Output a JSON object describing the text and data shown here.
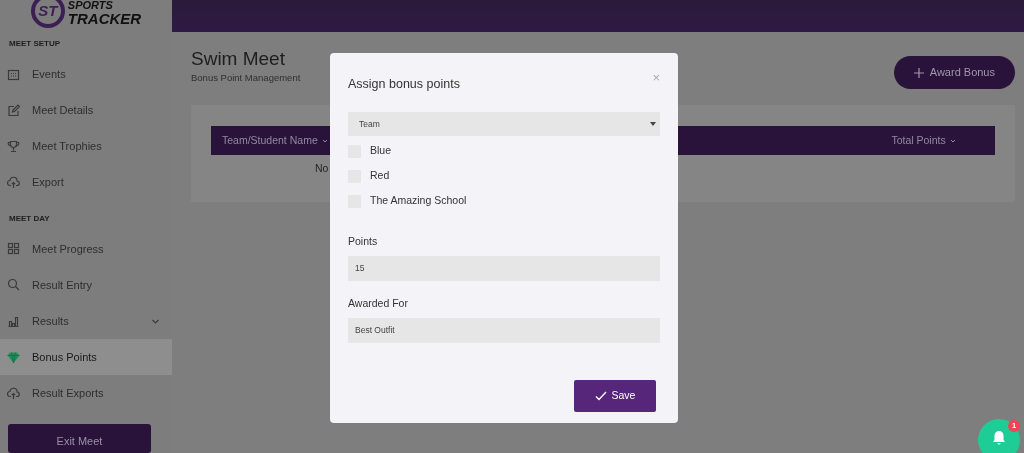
{
  "logo": {
    "mark": "ST",
    "line_1": "SPORTS",
    "line_2": "TRACKER"
  },
  "sidebar": {
    "sections": [
      {
        "title": "MEET SETUP",
        "items": [
          {
            "label": "Events",
            "selected": false,
            "submenu": false
          },
          {
            "label": "Meet Details",
            "selected": false,
            "submenu": false
          },
          {
            "label": "Meet Trophies",
            "selected": false,
            "submenu": false
          },
          {
            "label": "Export",
            "selected": false,
            "submenu": false
          }
        ]
      },
      {
        "title": "MEET DAY",
        "items": [
          {
            "label": "Meet Progress",
            "selected": false,
            "submenu": false
          },
          {
            "label": "Result Entry",
            "selected": false,
            "submenu": false
          },
          {
            "label": "Results",
            "selected": false,
            "submenu": true
          },
          {
            "label": "Bonus Points",
            "selected": true,
            "submenu": false
          },
          {
            "label": "Result Exports",
            "selected": false,
            "submenu": false
          }
        ]
      }
    ],
    "exit_button": "Exit Meet"
  },
  "page": {
    "title": "Swim Meet",
    "subtitle": "Bonus Point Management",
    "award_button": "Award Bonus",
    "table": {
      "columns": [
        {
          "label": "Team/Student Name"
        },
        {
          "label": "Total Points"
        }
      ],
      "empty_text": "No"
    }
  },
  "modal": {
    "title": "Assign bonus points",
    "close": "×",
    "select": {
      "value": "Team"
    },
    "options": [
      {
        "label": "Blue",
        "checked": false
      },
      {
        "label": "Red",
        "checked": false
      },
      {
        "label": "The Amazing School",
        "checked": false
      }
    ],
    "fields": [
      {
        "label": "Points",
        "value": "15"
      },
      {
        "label": "Awarded For",
        "value": "Best Outfit"
      }
    ],
    "save_button": "Save"
  },
  "notifications": {
    "count": "1"
  }
}
